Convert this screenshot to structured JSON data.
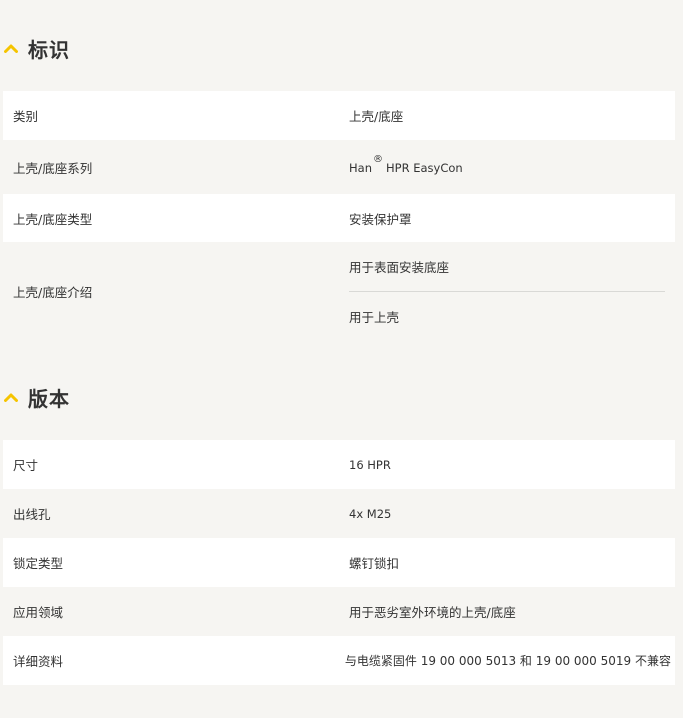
{
  "sections": {
    "identification": {
      "title": "标识",
      "rows": [
        {
          "label": "类别",
          "value": "上壳/底座"
        },
        {
          "label": "上壳/底座系列",
          "value_prefix": "Han",
          "value_mark": "®",
          "value_suffix": "HPR EasyCon"
        },
        {
          "label": "上壳/底座类型",
          "value": "安装保护罩"
        },
        {
          "label": "上壳/底座介绍",
          "values": [
            "用于表面安装底座",
            "用于上壳"
          ]
        }
      ]
    },
    "version": {
      "title": "版本",
      "rows": [
        {
          "label": "尺寸",
          "value": "16 HPR"
        },
        {
          "label": "出线孔",
          "value": "4x M25"
        },
        {
          "label": "锁定类型",
          "value": "螺钉锁扣"
        },
        {
          "label": "应用领域",
          "value": "用于恶劣室外环境的上壳/底座"
        },
        {
          "label": "详细资料",
          "value": "与电缆紧固件 19 00 000 5013 和 19 00 000 5019 不兼容"
        }
      ]
    }
  },
  "colors": {
    "accent": "#f5c400",
    "row_white": "#ffffff",
    "row_grey": "#f6f5f2",
    "text": "#333333"
  },
  "icons": {
    "section_toggle": "chevron-up-icon"
  }
}
